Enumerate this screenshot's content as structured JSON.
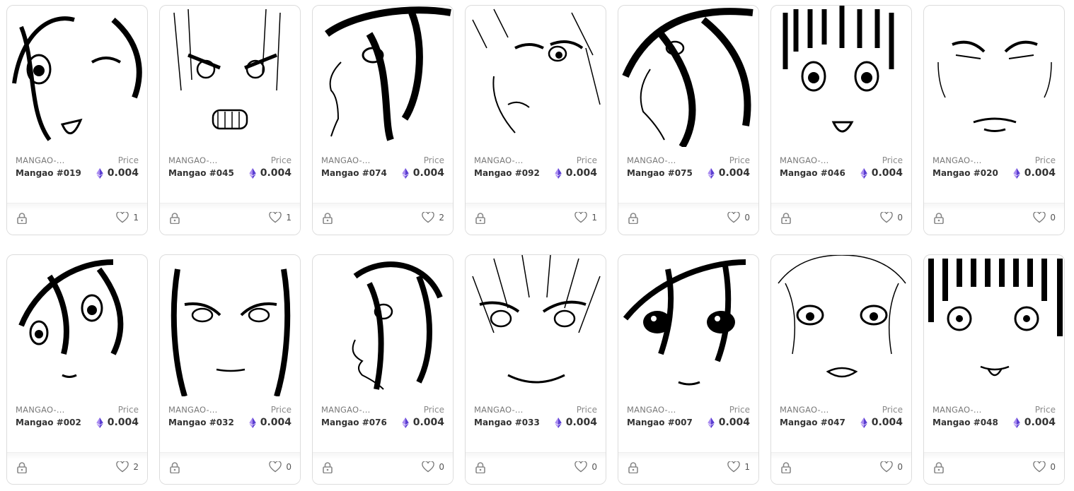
{
  "cards": [
    {
      "collection": "MANGAO-...",
      "name": "Mangao #019",
      "price_label": "Price",
      "price": "0.004",
      "likes": "1"
    },
    {
      "collection": "MANGAO-...",
      "name": "Mangao #045",
      "price_label": "Price",
      "price": "0.004",
      "likes": "1"
    },
    {
      "collection": "MANGAO-...",
      "name": "Mangao #074",
      "price_label": "Price",
      "price": "0.004",
      "likes": "2"
    },
    {
      "collection": "MANGAO-...",
      "name": "Mangao #092",
      "price_label": "Price",
      "price": "0.004",
      "likes": "1"
    },
    {
      "collection": "MANGAO-...",
      "name": "Mangao #075",
      "price_label": "Price",
      "price": "0.004",
      "likes": "0"
    },
    {
      "collection": "MANGAO-...",
      "name": "Mangao #046",
      "price_label": "Price",
      "price": "0.004",
      "likes": "0"
    },
    {
      "collection": "MANGAO-...",
      "name": "Mangao #020",
      "price_label": "Price",
      "price": "0.004",
      "likes": "0"
    },
    {
      "collection": "MANGAO-...",
      "name": "Mangao #002",
      "price_label": "Price",
      "price": "0.004",
      "likes": "2"
    },
    {
      "collection": "MANGAO-...",
      "name": "Mangao #032",
      "price_label": "Price",
      "price": "0.004",
      "likes": "0"
    },
    {
      "collection": "MANGAO-...",
      "name": "Mangao #076",
      "price_label": "Price",
      "price": "0.004",
      "likes": "0"
    },
    {
      "collection": "MANGAO-...",
      "name": "Mangao #033",
      "price_label": "Price",
      "price": "0.004",
      "likes": "0"
    },
    {
      "collection": "MANGAO-...",
      "name": "Mangao #007",
      "price_label": "Price",
      "price": "0.004",
      "likes": "1"
    },
    {
      "collection": "MANGAO-...",
      "name": "Mangao #047",
      "price_label": "Price",
      "price": "0.004",
      "likes": "0"
    },
    {
      "collection": "MANGAO-...",
      "name": "Mangao #048",
      "price_label": "Price",
      "price": "0.004",
      "likes": "0"
    }
  ],
  "icons": {
    "currency": "ethereum-icon",
    "lock": "lock-icon",
    "like": "heart-icon"
  },
  "colors": {
    "eth_dark": "#5b3fd1",
    "eth_light": "#a98bf0",
    "border": "#dcdcdc",
    "text": "#333333"
  }
}
